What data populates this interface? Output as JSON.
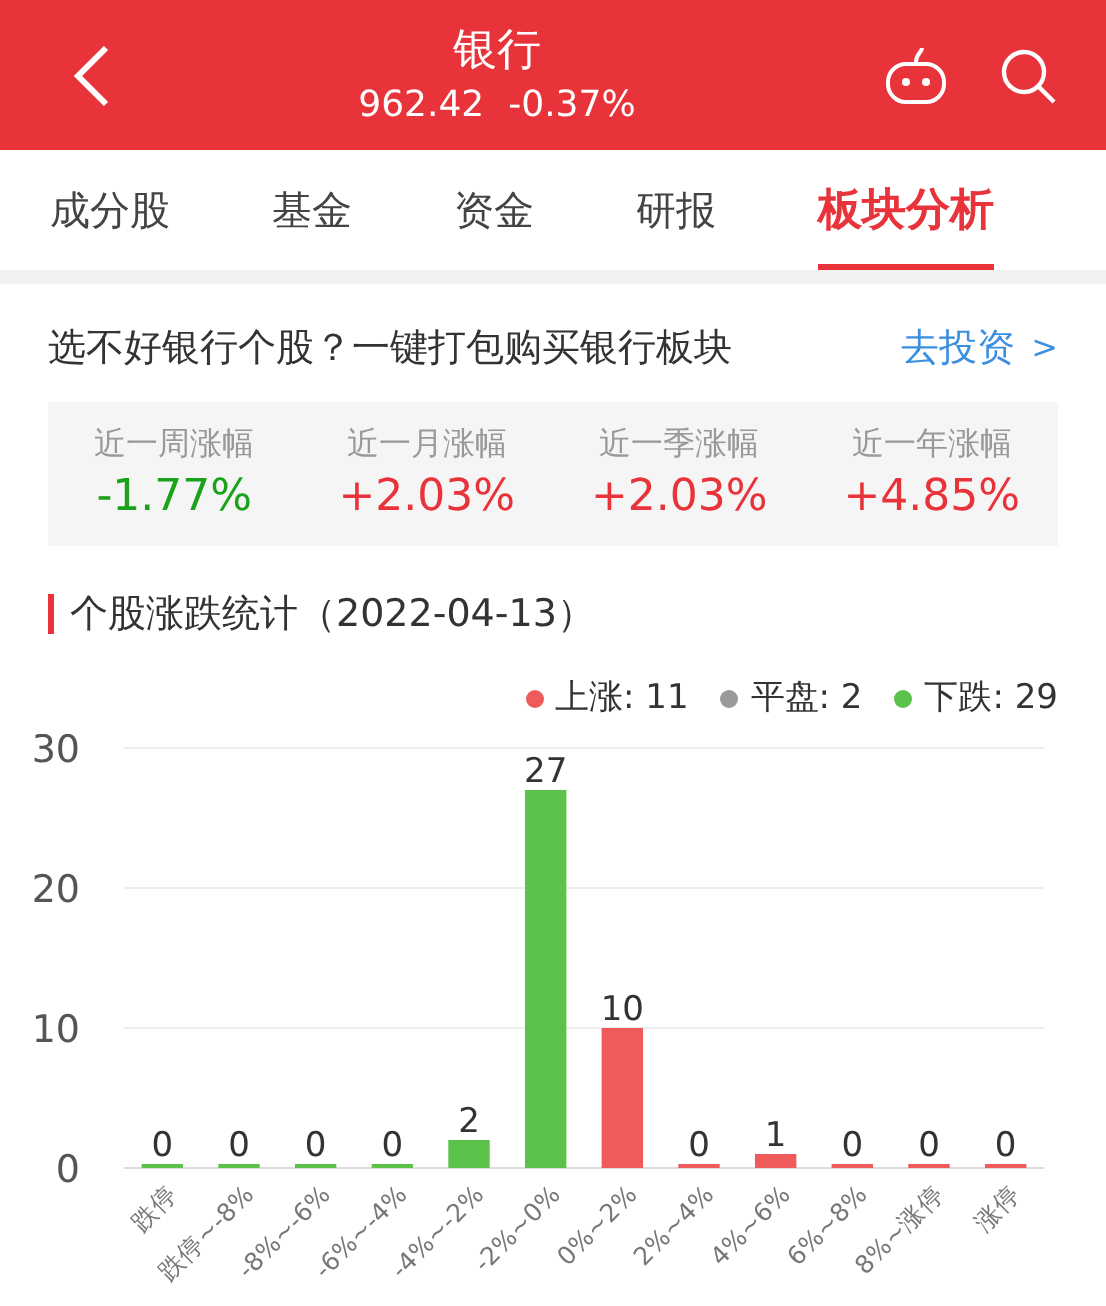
{
  "header": {
    "title": "银行",
    "price": "962.42",
    "change": "-0.37%"
  },
  "tabs": [
    {
      "label": "成分股",
      "selected": false
    },
    {
      "label": "基金",
      "selected": false
    },
    {
      "label": "资金",
      "selected": false
    },
    {
      "label": "研报",
      "selected": false
    },
    {
      "label": "板块分析",
      "selected": true
    }
  ],
  "promo": {
    "text": "选不好银行个股？一键打包购买银行板块",
    "link": "去投资",
    "link_arrow": ">"
  },
  "returns": [
    {
      "label": "近一周涨幅",
      "value": "-1.77%",
      "color": "#1aa31a"
    },
    {
      "label": "近一月涨幅",
      "value": "+2.03%",
      "color": "#e8333a"
    },
    {
      "label": "近一季涨幅",
      "value": "+2.03%",
      "color": "#e8333a"
    },
    {
      "label": "近一年涨幅",
      "value": "+4.85%",
      "color": "#e8333a"
    }
  ],
  "section_title": "个股涨跌统计（2022-04-13）",
  "legend": [
    {
      "label": "上涨: 11",
      "color": "#ef5b5b"
    },
    {
      "label": "平盘: 2",
      "color": "#999999"
    },
    {
      "label": "下跌: 29",
      "color": "#5cc34a"
    }
  ],
  "chart_data": {
    "type": "bar",
    "categories": [
      "跌停",
      "跌停~-8%",
      "-8%~-6%",
      "-6%~-4%",
      "-4%~-2%",
      "-2%~0%",
      "0%~2%",
      "2%~4%",
      "4%~6%",
      "6%~8%",
      "8%~涨停",
      "涨停"
    ],
    "series": [
      {
        "color": "#5cc34a",
        "values": [
          0,
          0,
          0,
          0,
          2,
          27,
          null,
          null,
          null,
          null,
          null,
          null
        ]
      },
      {
        "color": "#ef5b5b",
        "values": [
          null,
          null,
          null,
          null,
          null,
          null,
          10,
          0,
          1,
          0,
          0,
          0
        ]
      }
    ],
    "yticks": [
      0,
      10,
      20,
      30
    ],
    "ylim": [
      0,
      30
    ],
    "data_labels": true
  }
}
